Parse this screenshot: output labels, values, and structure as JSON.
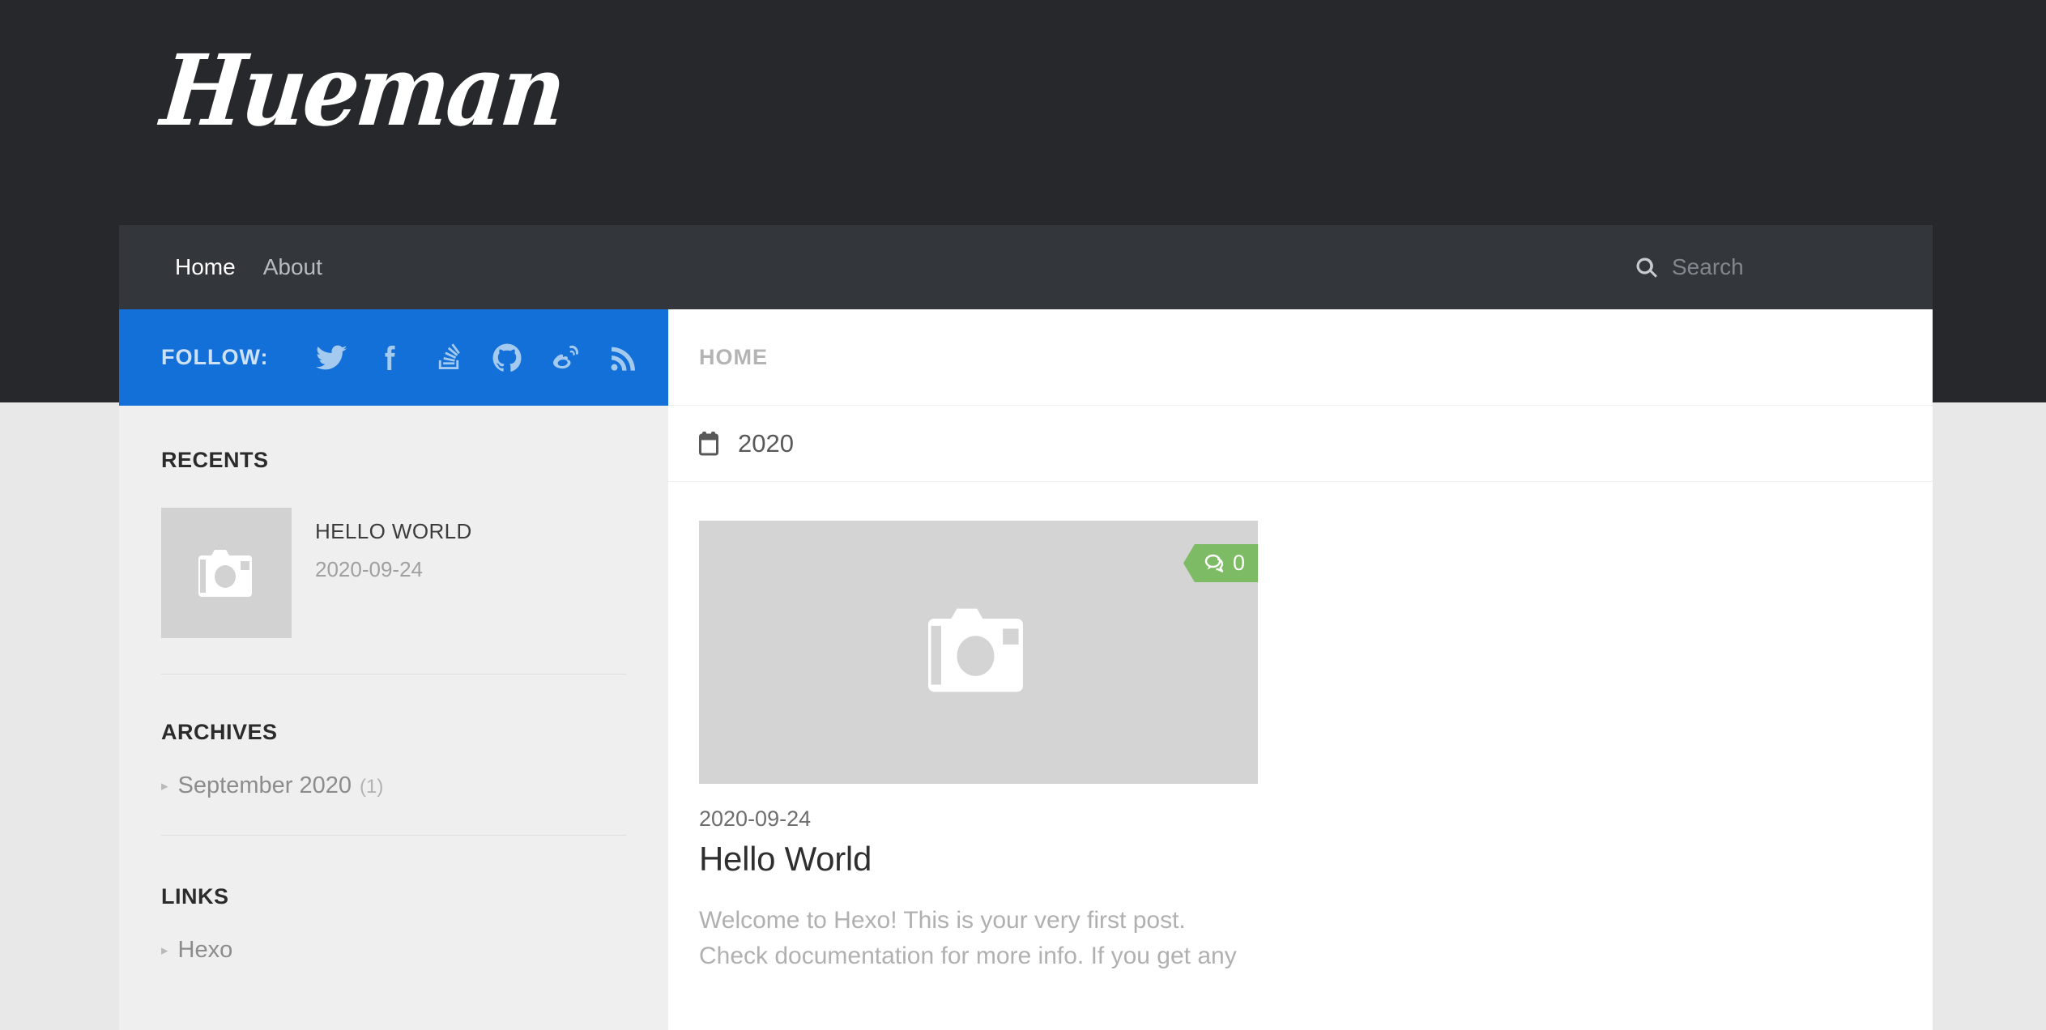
{
  "site": {
    "logo_text": "Hueman",
    "brand_blue": "#1270d8",
    "header_dark": "#26282b",
    "nav_dark": "#33363a",
    "badge_green": "#7dbb65"
  },
  "nav": {
    "items": [
      {
        "label": "Home",
        "active": true
      },
      {
        "label": "About",
        "active": false
      }
    ],
    "search": {
      "placeholder": "Search",
      "value": "",
      "icon": "search-icon"
    }
  },
  "sidebar": {
    "follow": {
      "label": "FOLLOW:",
      "socials": [
        {
          "name": "twitter-icon"
        },
        {
          "name": "facebook-icon"
        },
        {
          "name": "stackoverflow-icon"
        },
        {
          "name": "github-icon"
        },
        {
          "name": "weibo-icon"
        },
        {
          "name": "rss-icon"
        }
      ]
    },
    "recents": {
      "title": "RECENTS",
      "posts": [
        {
          "title": "HELLO WORLD",
          "date": "2020-09-24",
          "thumb_icon": "camera-placeholder-icon"
        }
      ]
    },
    "archives": {
      "title": "ARCHIVES",
      "items": [
        {
          "label": "September 2020",
          "count": "(1)"
        }
      ]
    },
    "links": {
      "title": "LINKS",
      "items": [
        {
          "label": "Hexo",
          "count": ""
        }
      ]
    }
  },
  "main": {
    "breadcrumb": [
      "HOME"
    ],
    "year_group": {
      "icon": "calendar-icon",
      "label": "2020"
    },
    "posts": [
      {
        "thumb_icon": "camera-placeholder-icon",
        "comments_icon": "comment-icon",
        "comments_count": "0",
        "date": "2020-09-24",
        "title": "Hello World",
        "excerpt": "Welcome to Hexo! This is your very first post. Check documentation for more info. If you get any"
      }
    ]
  }
}
